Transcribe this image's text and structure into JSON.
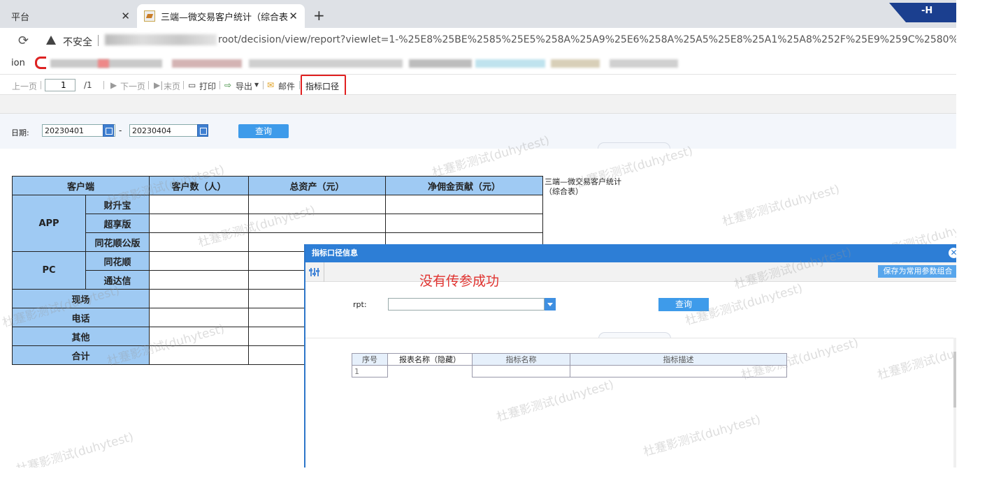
{
  "browser": {
    "tabs": [
      {
        "label": "平台",
        "active": false
      },
      {
        "label": "三端—微交易客户统计（综合表",
        "active": true
      }
    ],
    "new_tab_icon": "plus-icon",
    "window_button": "-H"
  },
  "addressbar": {
    "security_label": "不安全",
    "url_visible": "root/decision/view/report?viewlet=1-%25E8%25BE%2585%25E5%258A%25A9%25E6%258A%25A5%25E8%25A1%25A8%252F%25E9%259C%2580%25E6%25B1%25"
  },
  "bookmarks": {
    "label": "ion"
  },
  "report_toolbar": {
    "prev": "上一页",
    "page_value": "1",
    "page_total": "/1",
    "next": "下一页",
    "last": "末页",
    "print": "打印",
    "export": "导出",
    "mail": "邮件",
    "caliber": "指标口径"
  },
  "params": {
    "date_label": "日期:",
    "start_date": "20230401",
    "end_date": "20230404",
    "separator": "-",
    "query": "查询"
  },
  "report": {
    "headers": [
      "客户端",
      "客户数（人）",
      "总资产（元）",
      "净佣金贡献（元）"
    ],
    "groups": [
      {
        "name": "APP",
        "items": [
          "财升宝",
          "超享版",
          "同花顺公版"
        ]
      },
      {
        "name": "PC",
        "items": [
          "同花顺",
          "通达信"
        ]
      }
    ],
    "rows": [
      "现场",
      "电话",
      "其他",
      "合计"
    ],
    "side_title": "三端—微交易客户统计（综合表）"
  },
  "watermark": "杜蹇影测试(duhytest)",
  "dialog": {
    "title": "指标口径信息",
    "save_button": "保存为常用参数组合",
    "notice": "没有传参成功",
    "rpt_label": "rpt:",
    "rpt_value": "",
    "query": "查询",
    "table_headers": [
      "序号",
      "报表名称（隐藏）",
      "指标名称",
      "指标描述"
    ],
    "rows": [
      [
        "1",
        "",
        "",
        ""
      ]
    ]
  },
  "colors": {
    "accent": "#2d7ed6",
    "button": "#3e9bea",
    "header_cell": "#9fcaf3",
    "highlight": "#e02020",
    "notice": "#e0322f"
  }
}
